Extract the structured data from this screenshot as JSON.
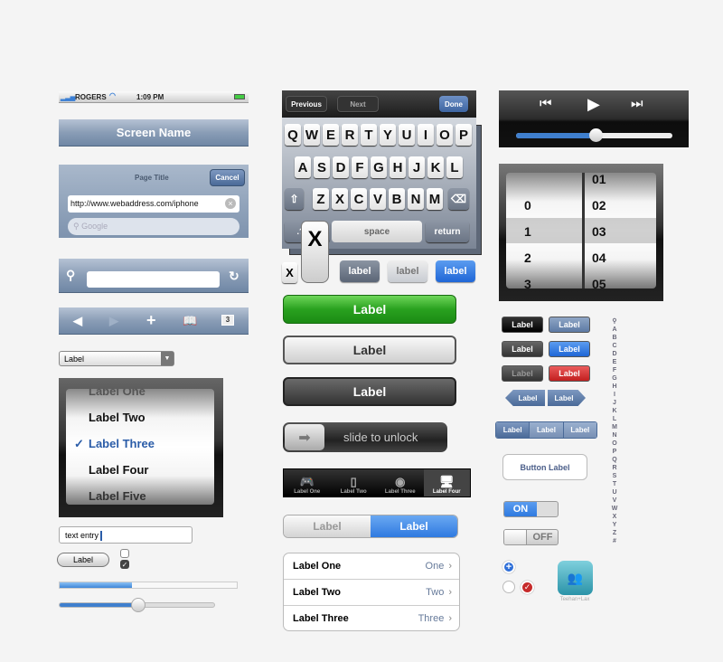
{
  "status_bar": {
    "carrier": "ROGERS",
    "time": "1:09 PM"
  },
  "nav_bar": {
    "title": "Screen Name"
  },
  "browser_header": {
    "title": "Page Title",
    "cancel": "Cancel",
    "url": "http://www.webaddress.com/iphone",
    "search_placeholder": "Google"
  },
  "toolbar": {
    "tabs_count": "3"
  },
  "dropdown": {
    "value": "Label"
  },
  "list_picker": {
    "items": [
      "Label One",
      "Label Two",
      "Label Three",
      "Label Four",
      "Label Five"
    ],
    "selected": "Label Three",
    "check": "✓"
  },
  "text_entry": {
    "value": "text entry"
  },
  "pill_button": {
    "label": "Label"
  },
  "progress": {
    "value": 0.41
  },
  "slider": {
    "value": 0.51
  },
  "keyboard": {
    "previous": "Previous",
    "next": "Next",
    "done": "Done",
    "row1": [
      "Q",
      "W",
      "E",
      "R",
      "T",
      "Y",
      "U",
      "I",
      "O",
      "P"
    ],
    "row2": [
      "A",
      "S",
      "D",
      "F",
      "G",
      "H",
      "J",
      "K",
      "L"
    ],
    "row3": [
      "Z",
      "X",
      "C",
      "V",
      "B",
      "N",
      "M"
    ],
    "numbers": ".?123",
    "space": "space",
    "return": "return",
    "popup_key": "X",
    "small_key": "X"
  },
  "small_labels": [
    "label",
    "label",
    "label"
  ],
  "big_buttons": [
    "Label",
    "Label",
    "Label"
  ],
  "slide_unlock": "slide to unlock",
  "tab_bar": {
    "items": [
      "Label One",
      "Label Two",
      "Label Three",
      "Label Four"
    ],
    "selected": 3
  },
  "segmented": [
    "Label",
    "Label"
  ],
  "table": [
    {
      "label": "Label One",
      "value": "One"
    },
    {
      "label": "Label Two",
      "value": "Two"
    },
    {
      "label": "Label Three",
      "value": "Three"
    }
  ],
  "media": {
    "progress": 0.51
  },
  "date_picker": {
    "col1": [
      "",
      "0",
      "1",
      "2",
      "3"
    ],
    "col2": [
      "01",
      "02",
      "03",
      "04",
      "05"
    ]
  },
  "right_buttons": {
    "label": "Label",
    "segments": [
      "Label",
      "Label",
      "Label"
    ],
    "outline": "Button Label"
  },
  "switches": {
    "on": "ON",
    "off": "OFF"
  },
  "app_icon": {
    "name": "Teehan+Lax"
  },
  "index": [
    "A",
    "B",
    "C",
    "D",
    "E",
    "F",
    "G",
    "H",
    "I",
    "J",
    "K",
    "L",
    "M",
    "N",
    "O",
    "P",
    "Q",
    "R",
    "S",
    "T",
    "U",
    "V",
    "W",
    "X",
    "Y",
    "Z",
    "#"
  ],
  "colors": {
    "accent_blue": "#3b7fe0",
    "nav_blue": "#7f94b0",
    "green": "#2fa02c",
    "red": "#c92a2a"
  }
}
